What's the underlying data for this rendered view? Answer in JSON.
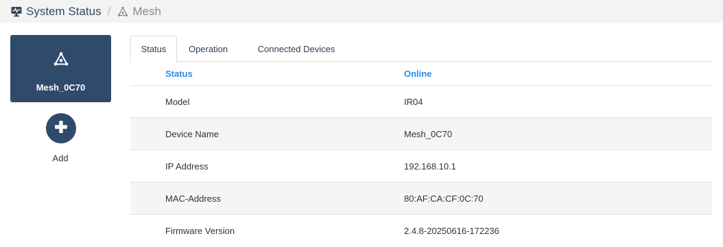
{
  "breadcrumb": {
    "section": "System Status",
    "separator": "/",
    "current": "Mesh"
  },
  "device_card": {
    "name": "Mesh_0C70",
    "icon": "mesh-icon"
  },
  "add": {
    "label": "Add",
    "icon": "plus-icon"
  },
  "tabs": [
    {
      "label": "Status",
      "active": true
    },
    {
      "label": "Operation",
      "active": false
    },
    {
      "label": "Connected Devices",
      "active": false
    }
  ],
  "status_table": {
    "header": {
      "key": "Status",
      "value": "Online"
    },
    "rows": [
      {
        "key": "Model",
        "value": "IR04"
      },
      {
        "key": "Device Name",
        "value": "Mesh_0C70"
      },
      {
        "key": "IP Address",
        "value": "192.168.10.1"
      },
      {
        "key": "MAC-Address",
        "value": "80:AF:CA:CF:0C:70"
      },
      {
        "key": "Firmware Version",
        "value": "2.4.8-20250616-172236"
      }
    ]
  },
  "colors": {
    "primary_dark": "#2f4a6b",
    "accent_blue": "#2d8ce0",
    "breadcrumb_bg": "#f3f3f3",
    "row_alt": "#f5f5f5"
  }
}
